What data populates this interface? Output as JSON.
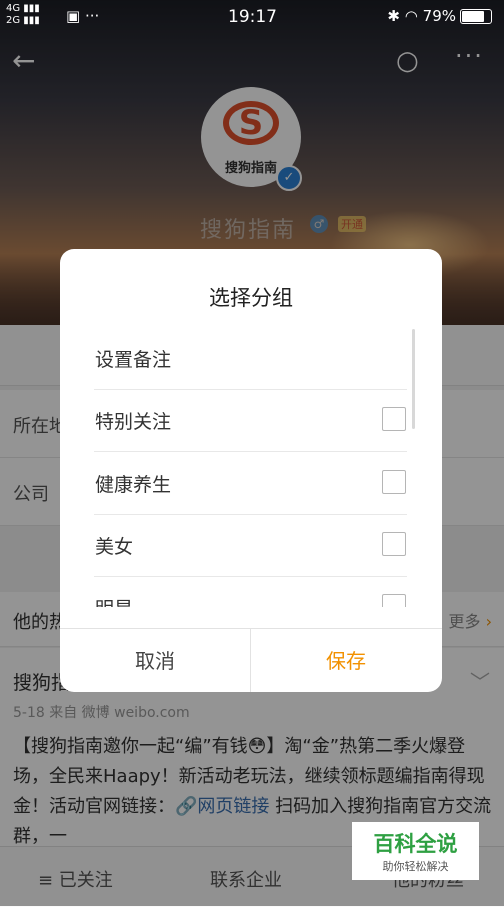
{
  "status_bar": {
    "signal1": "4G",
    "signal2": "2G",
    "time": "19:17",
    "battery": "79%"
  },
  "profile": {
    "name": "搜狗指南",
    "avatar_text": "搜狗指南",
    "logo_letter": "S",
    "vip_label": "开通"
  },
  "info_rows": [
    "所在地",
    "公司"
  ],
  "section": {
    "title": "他的热门",
    "more": "更多"
  },
  "post": {
    "author": "搜狗指南",
    "meta": "5-18  来自 微博 weibo.com",
    "text_before_link": "【搜狗指南邀你一起“编”有钱😳】淘“金”热第二季火爆登场，全民来Haapy！新活动老玩法，继续领标题编指南得现金！活动官网链接：",
    "link": "🔗网页链接",
    "text_after_link": " 扫码加入搜狗指南官方交流群，一"
  },
  "bottom_bar": {
    "followed": "≡ 已关注",
    "contact": "联系企业",
    "third": "他的粉丝"
  },
  "dialog": {
    "title": "选择分组",
    "items": [
      {
        "label": "设置备注",
        "checkbox": false
      },
      {
        "label": "特别关注",
        "checkbox": true,
        "checked": false
      },
      {
        "label": "健康养生",
        "checkbox": true,
        "checked": false
      },
      {
        "label": "美女",
        "checkbox": true,
        "checked": false
      },
      {
        "label": "明星",
        "checkbox": true,
        "checked": false
      }
    ],
    "cancel": "取消",
    "save": "保存"
  },
  "watermark": {
    "title": "百科全说",
    "subtitle": "助你轻松解决"
  },
  "colors": {
    "accent": "#f29100",
    "link": "#3a6fb0",
    "watermark": "#2ea042"
  }
}
